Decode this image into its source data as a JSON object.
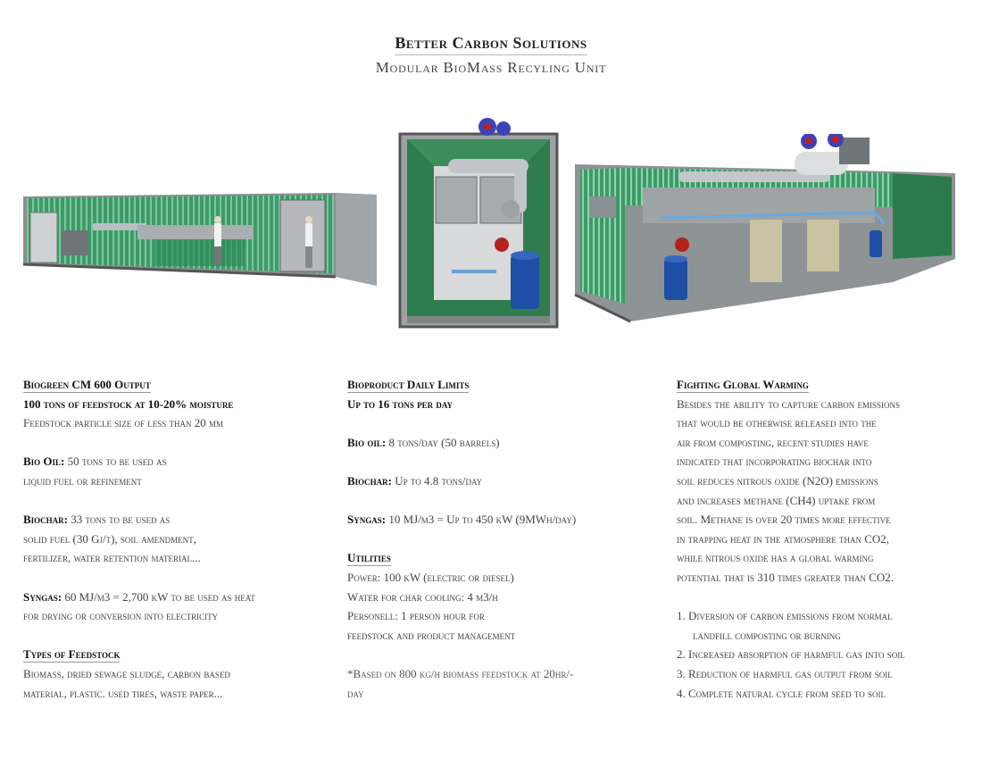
{
  "header": {
    "title": "Better Carbon Solutions",
    "subtitle": "Modular BioMass Recyling Unit"
  },
  "images": {
    "left": "container-exterior-render",
    "center": "container-end-view-render",
    "right": "container-cutaway-render"
  },
  "col1": {
    "heading": "Biogreen CM 600 Output",
    "output": "100 tons of feedstock at 10-20% moisture",
    "particle": "Feedstock particle size of less than 20 mm",
    "biooil_label": "Bio Oil:",
    "biooil_text_1": "50 tons to be used as",
    "biooil_text_2": "liquid fuel or refinement",
    "biochar_label": "Biochar:",
    "biochar_text_1": "33 tons to be used as",
    "biochar_text_2": "solid fuel (30 Gj/t), soil amendment,",
    "biochar_text_3": "fertilizer, water retention material...",
    "syngas_label": "Syngas:",
    "syngas_text_1": "60 MJ/m3 = 2,700 kW to be used as heat",
    "syngas_text_2": "for drying or conversion into electricity",
    "types_heading": "Types of Feedstock",
    "types_text_1": "Biomass, dried sewage sludge, carbon based",
    "types_text_2": "material, plastic. used tires, waste paper..."
  },
  "col2": {
    "heading": "Bioproduct Daily Limits",
    "limit": "Up to 16 tons per day",
    "biooil_label": "Bio oil:",
    "biooil_text": "8 tons/day (50 barrels)",
    "biochar_label": "Biochar:",
    "biochar_text": "Up to 4.8 tons/day",
    "syngas_label": "Syngas:",
    "syngas_text": "10 MJ/m3 = Up to 450 kW (9MWh/day)",
    "utilities_heading": "Utilities",
    "power": "Power: 100 kW (electric or diesel)",
    "water": "Water for char cooling: 4 m3/h",
    "personell_1": "Personell: 1 person hour for",
    "personell_2": "feedstock and product management",
    "footnote_1": "*Based on 800 kg/h biomass feedstock at 20hr/-",
    "footnote_2": "day"
  },
  "col3": {
    "heading": "Fighting Global Warming",
    "para": [
      "Besides the ability to capture carbon emissions",
      "that would be otherwise released into the",
      "air from composting, recent studies have",
      "indicated that incorporating biochar into",
      "soil reduces nitrous oxide (N2O) emissions",
      "and increases methane (CH4) uptake from",
      "soil. Methane is over 20 times more effective",
      "in trapping heat in the atmosphere than CO2,",
      "while nitrous oxide has a global warming",
      "potential that is 310 times greater than CO2."
    ],
    "list_1a": "1. Diversion of carbon emissions from normal",
    "list_1b": "landfill composting or burning",
    "list_2": "2. Increased absorption of harmful gas into soil",
    "list_3": "3. Reduction of harmful gas output from soil",
    "list_4": "4. Complete natural cycle from seed to soil"
  }
}
